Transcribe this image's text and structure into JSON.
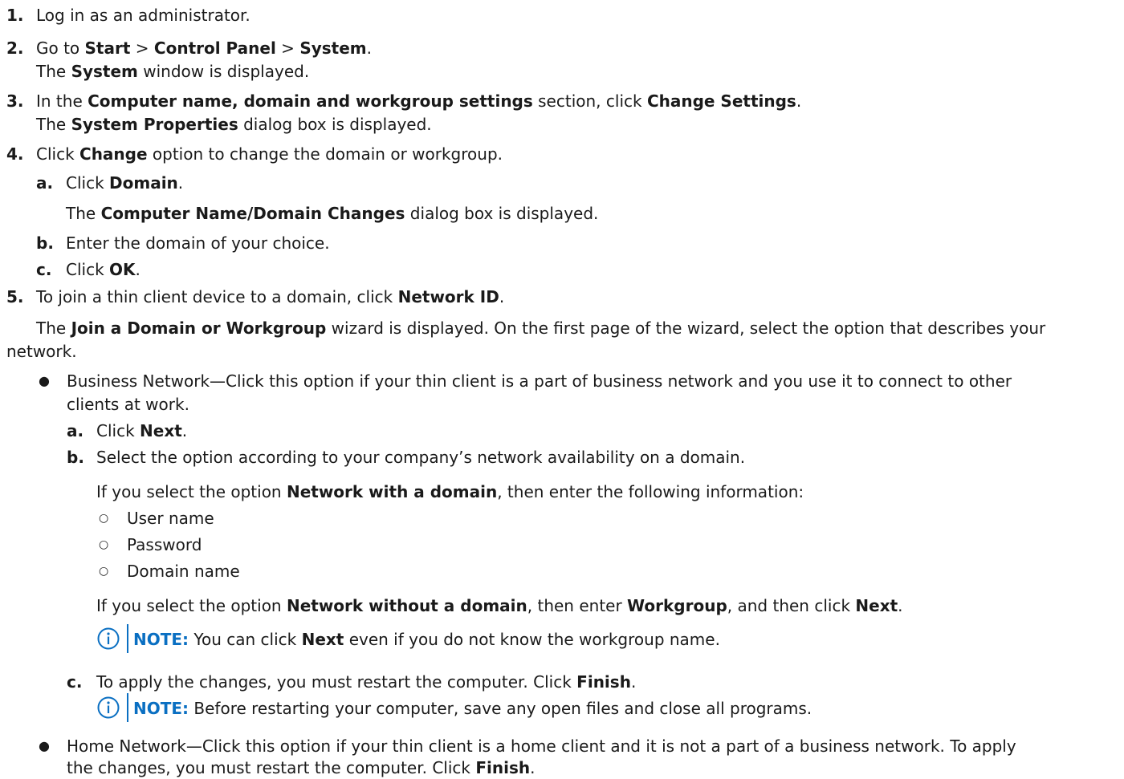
{
  "steps": {
    "s1": {
      "num": "1.",
      "text": "Log in as an administrator."
    },
    "s2": {
      "num": "2.",
      "t1": "Go to ",
      "b1": "Start",
      "t2": " > ",
      "b2": "Control Panel",
      "t3": " > ",
      "b3": "System",
      "t4": ".",
      "r1": "The ",
      "rb": "System",
      "r2": " window is displayed."
    },
    "s3": {
      "num": "3.",
      "t1": "In the ",
      "b1": "Computer name, domain and workgroup settings",
      "t2": " section, click ",
      "b2": "Change Settings",
      "t3": ".",
      "r1": "The ",
      "rb": "System Properties",
      "r2": " dialog box is displayed."
    },
    "s4": {
      "num": "4.",
      "t1": "Click ",
      "b1": "Change",
      "t2": " option to change the domain or workgroup.",
      "a": {
        "lbl": "a.",
        "t1": "Click ",
        "b1": "Domain",
        "t2": "."
      },
      "a_res": {
        "t1": "The ",
        "b1": "Computer Name/Domain Changes",
        "t2": " dialog box is displayed."
      },
      "b": {
        "lbl": "b.",
        "t1": "Enter the domain of your choice."
      },
      "c": {
        "lbl": "c.",
        "t1": "Click ",
        "b1": "OK",
        "t2": "."
      }
    },
    "s5": {
      "num": "5.",
      "t1": "To join a thin client device to a domain, click ",
      "b1": "Network ID",
      "t2": ".",
      "p1": "The ",
      "pb": "Join a Domain or Workgroup",
      "p2": " wizard is displayed. On the first page of the wizard, select the option that describes your",
      "p3": "network."
    }
  },
  "business": {
    "line1": "Business Network—Click this option if your thin client is a part of business network and you use it to connect to other",
    "line2": "clients at work.",
    "a": {
      "lbl": "a.",
      "t1": "Click ",
      "b1": "Next",
      "t2": "."
    },
    "b": {
      "lbl": "b.",
      "t1": "Select the option according to your company’s network availability on a domain."
    },
    "with_domain": {
      "t1": "If you select the option ",
      "b1": "Network with a domain",
      "t2": ", then enter the following information:"
    },
    "fields": [
      "User name",
      "Password",
      "Domain name"
    ],
    "without_domain": {
      "t1": "If you select the option ",
      "b1": "Network without a domain",
      "t2": ", then enter ",
      "b2": "Workgroup",
      "t3": ", and then click ",
      "b3": "Next",
      "t4": "."
    },
    "note1": {
      "label": "NOTE:",
      "t1": " You can click ",
      "b1": "Next",
      "t2": " even if you do not know the workgroup name."
    },
    "c": {
      "lbl": "c.",
      "t1": "To apply the changes, you must restart the computer. Click ",
      "b1": "Finish",
      "t2": "."
    },
    "note2": {
      "label": "NOTE:",
      "t1": " Before restarting your computer, save any open files and close all programs."
    }
  },
  "home": {
    "line1": "Home Network—Click this option if your thin client is a home client and it is not a part of a business network. To apply",
    "l2_t1": "the changes, you must restart the computer. Click ",
    "l2_b1": "Finish",
    "l2_t2": "."
  },
  "colors": {
    "note_accent": "#0a6fc2",
    "text": "#1a1a1a"
  },
  "icons": {
    "note": "info-circle-icon",
    "bullet": "filled-bullet",
    "sub_bullet": "hollow-circle-bullet"
  }
}
